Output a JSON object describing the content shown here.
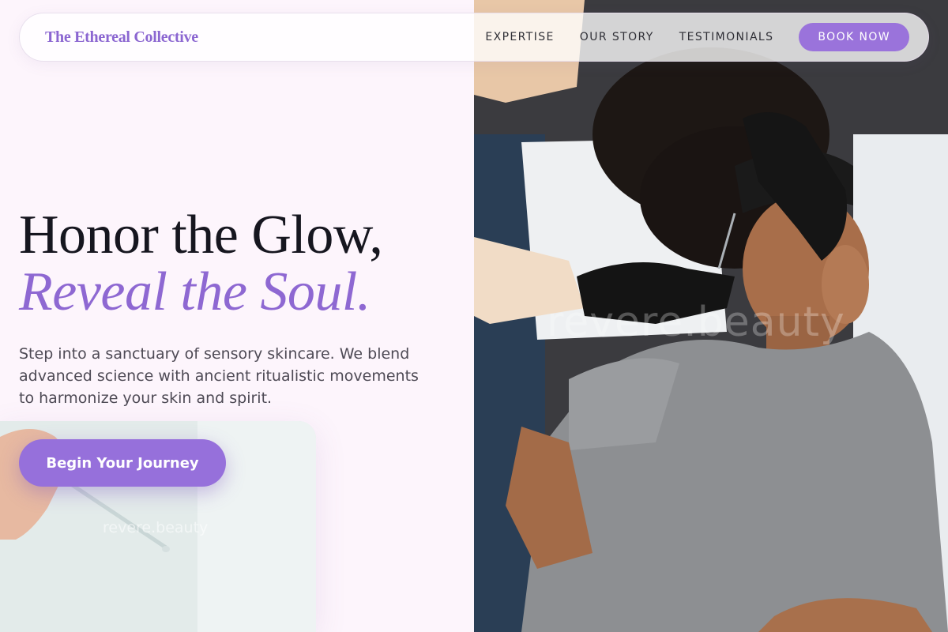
{
  "header": {
    "brand": "The Ethereal Collective",
    "nav": [
      {
        "label": "EXPERTISE"
      },
      {
        "label": "OUR STORY"
      },
      {
        "label": "TESTIMONIALS"
      }
    ],
    "book_label": "BOOK NOW"
  },
  "hero": {
    "headline_line1": "Honor the Glow,",
    "headline_line2": "Reveal the Soul.",
    "subtext": "Step into a sanctuary of sensory skincare. We blend advanced science with ancient ritualistic movements to harmonize your skin and spirit.",
    "cta_label": "Begin Your Journey"
  },
  "images": {
    "hero_watermark": "revere.beauty",
    "serum_watermark": "revere.beauty"
  },
  "colors": {
    "page_bg": "#fdf5fc",
    "accent": "#9a73db",
    "brand_text": "#8b66d1",
    "headline_text": "#16161f",
    "body_text": "#4e4a55"
  }
}
